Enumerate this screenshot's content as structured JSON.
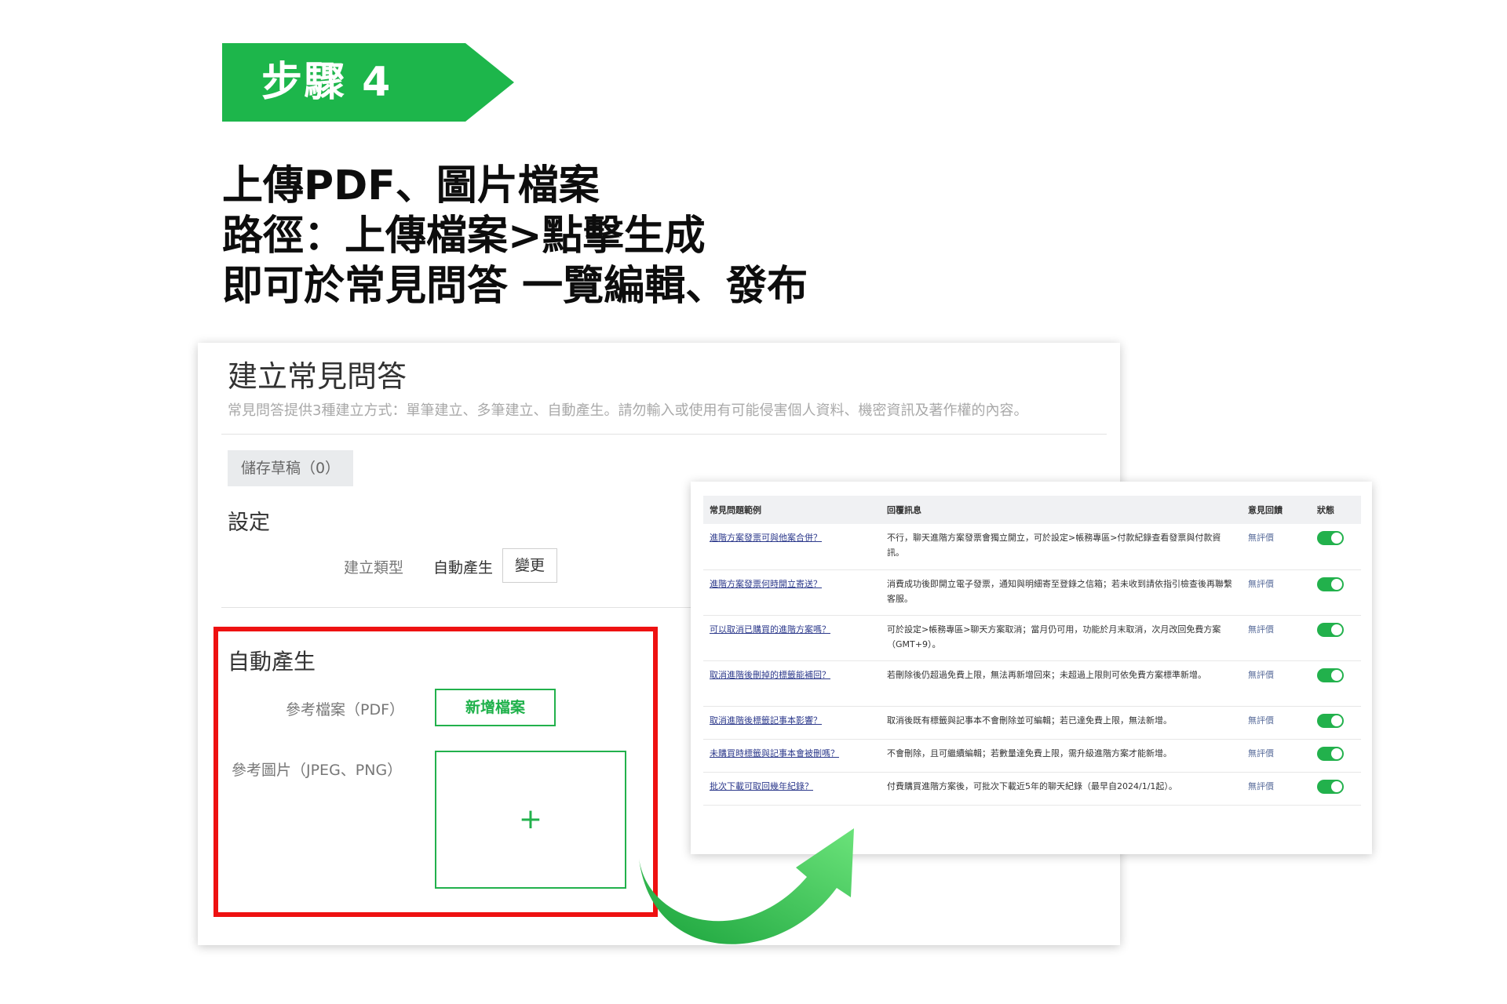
{
  "step": {
    "label": "步驟 4",
    "color": "#1db64b"
  },
  "headline": {
    "lines": [
      "上傳PDF、圖片檔案",
      "路徑：上傳檔案>點擊生成",
      "即可於常見問答 一覽編輯、發布"
    ]
  },
  "left_panel": {
    "title": "建立常見問答",
    "description": "常見問答提供3種建立方式：單筆建立、多筆建立、自動產生。請勿輸入或使用有可能侵害個人資料、機密資訊及著作權的內容。",
    "draft_button": "儲存草稿（0）",
    "settings_title": "設定",
    "type_label": "建立類型",
    "type_value": "自動產生",
    "change_button": "變更",
    "auto_section": {
      "title": "自動產生",
      "pdf_label": "參考檔案（PDF）",
      "add_file_button": "新增檔案",
      "image_label": "參考圖片（JPEG、PNG）",
      "upload_plus": "+"
    }
  },
  "right_panel": {
    "headers": [
      "常見問題範例",
      "回覆訊息",
      "意見回饋",
      "狀態"
    ],
    "rows": [
      {
        "question": "進階方案發票可與他案合併？",
        "answer": "不行，聊天進階方案發票會獨立開立，可於設定>帳務專區>付款紀錄查看發票與付款資訊。",
        "feedback": "無評價"
      },
      {
        "question": "進階方案發票何時開立寄送？",
        "answer": "消費成功後即開立電子發票，通知與明細寄至登錄之信箱；若未收到請依指引檢查後再聯繫客服。",
        "feedback": "無評價"
      },
      {
        "question": "可以取消已購買的進階方案嗎？",
        "answer": "可於設定>帳務專區>聊天方案取消；當月仍可用，功能於月末取消，次月改回免費方案（GMT+9）。",
        "feedback": "無評價"
      },
      {
        "question": "取消進階後刪掉的標籤能補回？",
        "answer": "若刪除後仍超過免費上限，無法再新增回來；未超過上限則可依免費方案標準新增。",
        "feedback": "無評價"
      },
      {
        "question": "取消進階後標籤記事本影響？",
        "answer": "取消後既有標籤與記事本不會刪除並可編輯；若已達免費上限，無法新增。",
        "feedback": "無評價"
      },
      {
        "question": "未購買時標籤與記事本會被刪嗎？",
        "answer": "不會刪除，且可繼續編輯；若數量達免費上限，需升級進階方案才能新增。",
        "feedback": "無評價"
      },
      {
        "question": "批次下載可取回幾年紀錄？",
        "answer": "付費購買進階方案後，可批次下載近5年的聊天紀錄（最早自2024/1/1起）。",
        "feedback": "無評價"
      }
    ],
    "toggle_color": "#22b14c"
  },
  "arrow": {
    "color_start": "#1aa33c",
    "color_end": "#6be37a"
  },
  "highlight_color": "#ee1111"
}
